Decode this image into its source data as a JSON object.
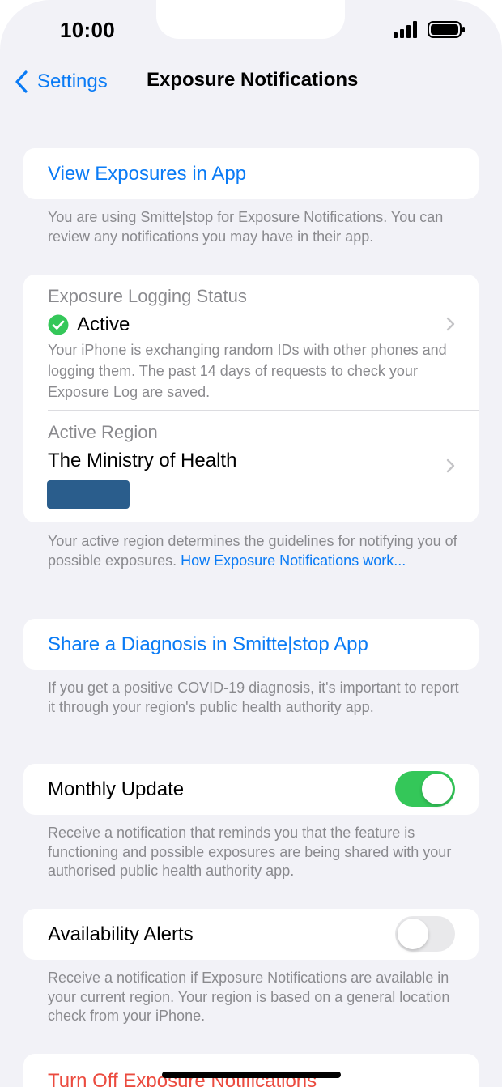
{
  "status_bar": {
    "time": "10:00"
  },
  "nav": {
    "back_label": "Settings",
    "title": "Exposure Notifications"
  },
  "view_exposures": {
    "link": "View Exposures in App",
    "footer": "You are using Smitte|stop for Exposure Notifications. You can review any notifications you may have in their app."
  },
  "logging": {
    "label": "Exposure Logging Status",
    "status": "Active",
    "description": "Your iPhone is exchanging random IDs with other phones and logging them. The past 14 days of requests to check your Exposure Log are saved."
  },
  "region": {
    "label": "Active Region",
    "name": "The Ministry of Health",
    "footer_text": "Your active region determines the guidelines for notifying you of possible exposures. ",
    "footer_link": "How Exposure Notifications work..."
  },
  "share": {
    "link": "Share a Diagnosis in Smitte|stop App",
    "footer": "If you get a positive COVID-19 diagnosis, it's important to report it through your region's public health authority app."
  },
  "monthly_update": {
    "label": "Monthly Update",
    "enabled": true,
    "footer": "Receive a notification that reminds you that the feature is functioning and possible exposures are being shared with your authorised public health authority app."
  },
  "availability": {
    "label": "Availability Alerts",
    "enabled": false,
    "footer": "Receive a notification if Exposure Notifications are available in your current region. Your region is based on a general location check from your iPhone."
  },
  "turn_off": {
    "label": "Turn Off Exposure Notifications"
  },
  "colors": {
    "accent": "#0a7bf5",
    "toggle_on": "#34c759",
    "destructive": "#eb4b3f",
    "status_ok": "#34c759"
  }
}
